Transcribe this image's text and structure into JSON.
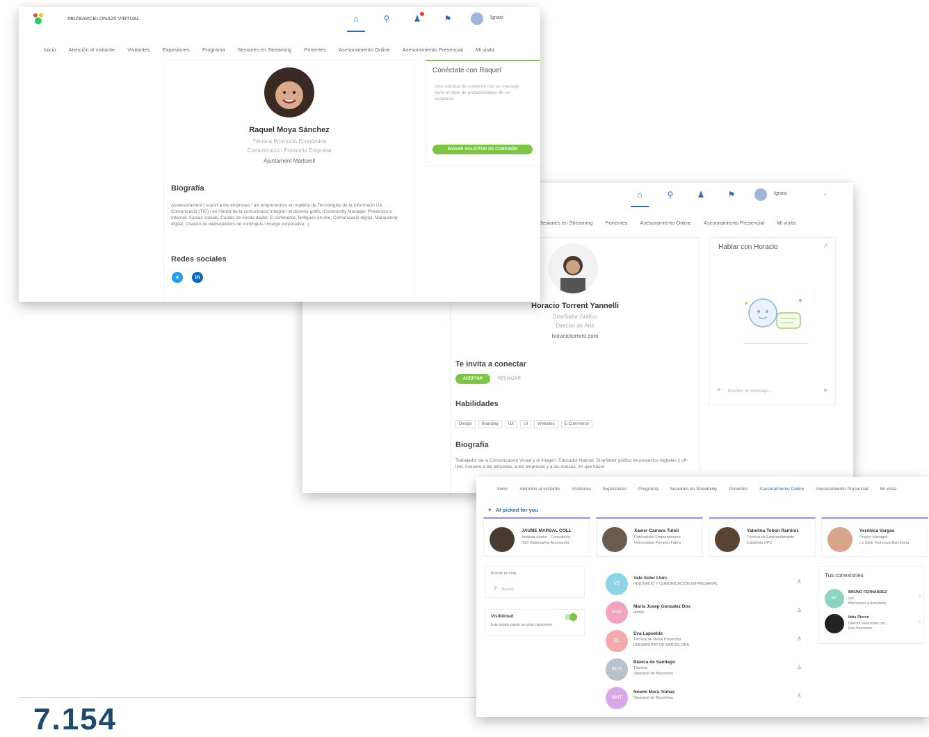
{
  "window1": {
    "app_title": "#BIZBARCELONA20 VIRTUAL",
    "user_name": "Ignasi",
    "nav": [
      "Inicio",
      "Atención al visitante",
      "Visitantes",
      "Expositores",
      "Programa",
      "Sesiones en Streaming",
      "Ponentes",
      "Asesoramiento Online",
      "Asesoramiento Presencial",
      "Mi visita"
    ],
    "profile": {
      "name": "Raquel Moya Sánchez",
      "line1": "Técnica Promoció Econòmica",
      "line2": "Comunicació i Promoció Empresa",
      "line3": "Ajuntament Martorell"
    },
    "bio_title": "Biografía",
    "bio_text": "Assessorament i suport a les empreses i als emprenedors en matèria de Tecnologies de la Informació i la Comunicació (TIC) i en l'àmbit de la comunicació integral i el disseny gràfic (Community Manager, Presència a Internet, Xarxes socials, Canals de venda digital, E-commerce, Botigues on-line, Comunicació digital, Marqueting digital, Creació de webs/gestors de continguts i imatge corporativa...)",
    "social_title": "Redes sociales",
    "connect_title": "Conéctate con Raquel",
    "connect_hint": "Una solicitud de conexión con un mensaje tiene el triple de probabilidades de ser aceptada.",
    "connect_button": "ENVIAR SOLICITUD DE CONEXIÓN"
  },
  "window2": {
    "user_name": "Ignasi",
    "nav": [
      "Sesiones en Streaming",
      "Ponentes",
      "Asesoramiento Online",
      "Asesoramiento Presencial",
      "Mi visita"
    ],
    "profile": {
      "name": "Horacio Torrent Yannelli",
      "line1": "Diseñador Gráfico",
      "line2": "Director de Arte",
      "line3": "horaciotorrent.com"
    },
    "invite_title": "Te invita a conectar",
    "accept_button": "ACEPTAR",
    "reject_button": "RECHAZAR",
    "skills_title": "Habilidades",
    "skills": [
      "Design",
      "Branding",
      "UX",
      "UI",
      "Websites",
      "E-Commerce"
    ],
    "bio_title": "Biografía",
    "bio_text": "Trabajador de la Comunicación Visual y la imagen. Educador Natural. Diseñador gráfico de proyectos digitales y off-line. Asesoro a las personas, a las empresas y a las marcas, en que hacer",
    "chat_title": "Hablar con Horacio",
    "chat_placeholder": "Escribir un mensaje..."
  },
  "window3": {
    "nav": [
      "Inicio",
      "Atención al visitante",
      "Visitantes",
      "Expositores",
      "Programa",
      "Sesiones en Streaming",
      "Ponentes",
      "Asesoramiento Online",
      "Asesoramiento Presencial",
      "Mi visita"
    ],
    "ai_title": "AI picked for you",
    "suggestions": [
      {
        "name": "JAUME MARSAL COLL",
        "sub1": "Analista Senior - Consultoría",
        "sub2": "IWS Datamarket Assessoria"
      },
      {
        "name": "Xavier Camara Tutoli",
        "sub1": "Cofundador Emprendedora",
        "sub2": "Universidad Pompeu Fabra"
      },
      {
        "name": "Yabelina Tobón Ramírez",
        "sub1": "Técnica de Emprendimiento",
        "sub2": "Catalonia UPC"
      },
      {
        "name": "Verónica Vargas",
        "sub1": "Project Manager",
        "sub2": "La Salle Technova Barcelona"
      }
    ],
    "search_label": "Buscar en lista",
    "search_placeholder": "Buscar",
    "visibility_label": "Visibilidad",
    "visibility_hint": "Este estado puede ser visto claramente",
    "people": [
      {
        "initials": "VS",
        "name": "Vale Soler Llurc",
        "sub1": "INNOVACIÓ Y COMUNICACIÓN EMPRESARIAL",
        "sub2": "",
        "color": "#8fd3e8"
      },
      {
        "initials": "MJG",
        "name": "Maria Josep Gonzalez Dos",
        "sub1": "admin",
        "sub2": "",
        "color": "#f2a3bf"
      },
      {
        "initials": "EL",
        "name": "Eva Lapuebla",
        "sub1": "Técnica de Retail Proyectos",
        "sub2": "UNIVERSITAT DE BARCELONA",
        "color": "#f5a9a9"
      },
      {
        "initials": "BDS",
        "name": "Blanca de Santiago",
        "sub1": "Técnica",
        "sub2": "Diputació de Barcelona",
        "color": "#b7c2cc"
      },
      {
        "initials": "NMT",
        "name": "Noemí Mora Tomas",
        "sub1": "Diputació de Barcelona",
        "sub2": "",
        "color": "#d9a6e6"
      }
    ],
    "connections_title": "Tus conexiones",
    "connections": [
      {
        "initials": "BF",
        "name": "BRUNO FERNANDEZ",
        "sub1": "ceo",
        "sub2": "Bfernandez & Asociados",
        "color": "#8fd3c2"
      },
      {
        "initials": "",
        "name": "Idris Pierce",
        "sub1": "Director Relaciones con...",
        "sub2": "Eina Barcelona",
        "color": "#222"
      }
    ]
  },
  "footer_number": "7.154"
}
